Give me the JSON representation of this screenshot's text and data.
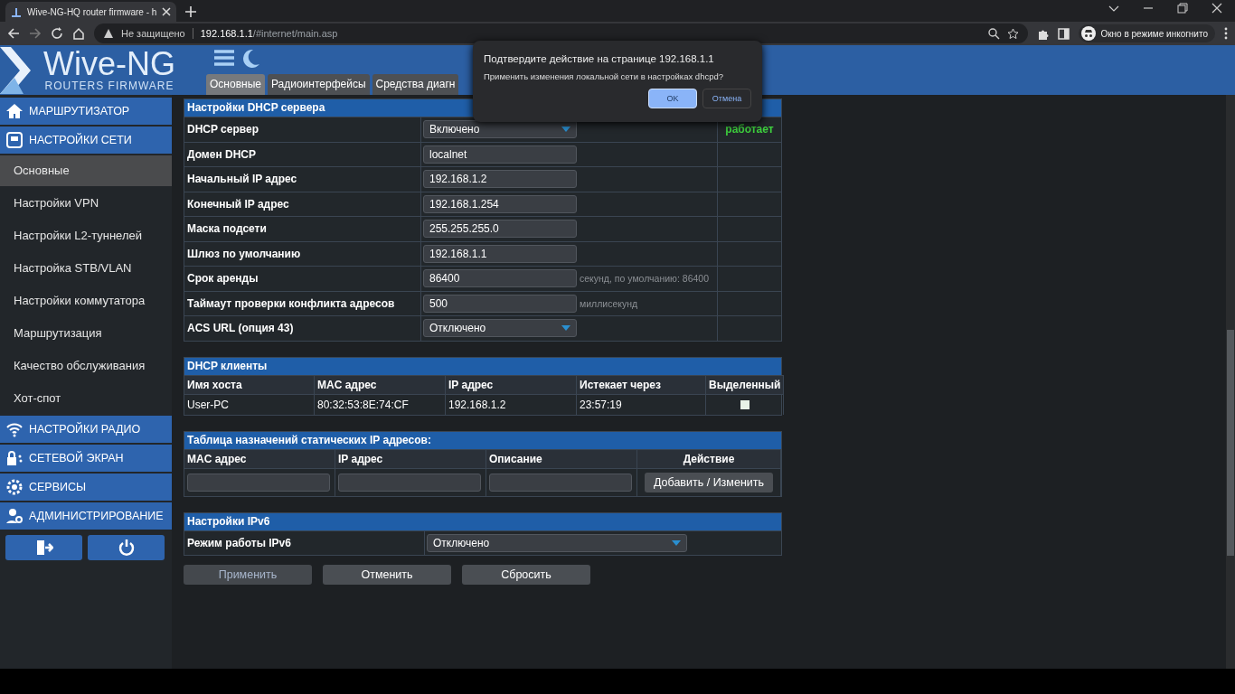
{
  "browser": {
    "tab_title": "Wive-NG-HQ router firmware - h",
    "security": "Не защищено",
    "url_host": "192.168.1.1",
    "url_path": "/#internet/main.asp",
    "profile": "Окно в режиме инкогнито"
  },
  "header": {
    "logo_title": "Wive-NG",
    "logo_subtitle": "ROUTERS FIRMWARE",
    "tabs": [
      {
        "label": "Основные",
        "selected": true
      },
      {
        "label": "Радиоинтерфейсы",
        "selected": false
      },
      {
        "label": "Средства диагн",
        "selected": false
      }
    ]
  },
  "sidebar": {
    "items": [
      {
        "kind": "section",
        "label": "МАРШРУТИЗАТОР",
        "selected": false
      },
      {
        "kind": "section",
        "label": "НАСТРОЙКИ СЕТИ",
        "selected": false
      },
      {
        "kind": "subitem",
        "label": "Основные",
        "selected": true
      },
      {
        "kind": "subitem",
        "label": "Настройки VPN",
        "selected": false
      },
      {
        "kind": "subitem",
        "label": "Настройки L2-туннелей",
        "selected": false
      },
      {
        "kind": "subitem",
        "label": "Настройка STB/VLAN",
        "selected": false
      },
      {
        "kind": "subitem",
        "label": "Настройки коммутатора",
        "selected": false
      },
      {
        "kind": "subitem",
        "label": "Маршрутизация",
        "selected": false
      },
      {
        "kind": "subitem",
        "label": "Качество обслуживания",
        "selected": false
      },
      {
        "kind": "subitem",
        "label": "Хот-спот",
        "selected": false
      },
      {
        "kind": "section",
        "label": "НАСТРОЙКИ РАДИО",
        "selected": false
      },
      {
        "kind": "section",
        "label": "СЕТЕВОЙ ЭКРАН",
        "selected": false
      },
      {
        "kind": "section",
        "label": "СЕРВИСЫ",
        "selected": false
      },
      {
        "kind": "section",
        "label": "АДМИНИСТРИРОВАНИЕ",
        "selected": false
      }
    ]
  },
  "dhcp_server": {
    "title": "Настройки DHCP сервера",
    "rows": [
      {
        "label": "DHCP сервер",
        "kind": "select",
        "value": "Включено",
        "status": "работает"
      },
      {
        "label": "Домен DHCP",
        "kind": "input",
        "value": "localnet"
      },
      {
        "label": "Начальный IP адрес",
        "kind": "input",
        "value": "192.168.1.2"
      },
      {
        "label": "Конечный IP адрес",
        "kind": "input",
        "value": "192.168.1.254"
      },
      {
        "label": "Маска подсети",
        "kind": "input",
        "value": "255.255.255.0"
      },
      {
        "label": "Шлюз по умолчанию",
        "kind": "input",
        "value": "192.168.1.1"
      },
      {
        "label": "Срок аренды",
        "kind": "input",
        "value": "86400",
        "note": "секунд, по умолчанию: 86400"
      },
      {
        "label": "Таймаут проверки конфликта адресов",
        "kind": "input",
        "value": "500",
        "note": "миллисекунд"
      },
      {
        "label": "ACS URL (опция 43)",
        "kind": "select",
        "value": "Отключено"
      }
    ]
  },
  "dhcp_clients": {
    "title": "DHCP клиенты",
    "columns": [
      "Имя хоста",
      "MAC адрес",
      "IP адрес",
      "Истекает через",
      "Выделенный"
    ],
    "rows": [
      {
        "cells": [
          "User-PC",
          "80:32:53:8E:74:CF",
          "192.168.1.2",
          "23:57:19"
        ],
        "checked": false
      }
    ]
  },
  "static_table": {
    "title": "Таблица назначений статических IP адресов:",
    "columns": [
      "MAC адрес",
      "IP адрес",
      "Описание",
      "Действие"
    ],
    "add_button": "Добавить / Изменить"
  },
  "ipv6": {
    "title": "Настройки IPv6",
    "rows": [
      {
        "label": "Режим работы IPv6",
        "value": "Отключено"
      }
    ]
  },
  "buttons": [
    {
      "label": "Применить",
      "disabled": true
    },
    {
      "label": "Отменить",
      "disabled": false
    },
    {
      "label": "Сбросить",
      "disabled": false
    }
  ],
  "dialog": {
    "title": "Подтвердите действие на странице 192.168.1.1",
    "message": "Применить изменения локальной сети в настройках dhcpd?",
    "ok": "OK",
    "cancel": "Отмена"
  }
}
